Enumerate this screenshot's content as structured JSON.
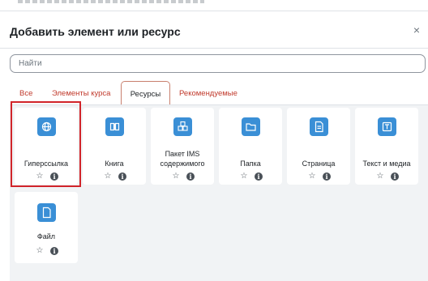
{
  "modal": {
    "title": "Добавить элемент или ресурс",
    "close_glyph": "×"
  },
  "search": {
    "placeholder": "Найти",
    "value": ""
  },
  "tabs": [
    {
      "label": "Все",
      "active": false
    },
    {
      "label": "Элементы курса",
      "active": false
    },
    {
      "label": "Ресурсы",
      "active": true
    },
    {
      "label": "Рекомендуемые",
      "active": false
    }
  ],
  "cards": [
    {
      "label": "Гиперссылка",
      "icon": "globe-icon",
      "selected": true
    },
    {
      "label": "Книга",
      "icon": "book-icon",
      "selected": false
    },
    {
      "label": "Пакет IMS содержимого",
      "icon": "package-icon",
      "selected": false
    },
    {
      "label": "Папка",
      "icon": "folder-icon",
      "selected": false
    },
    {
      "label": "Страница",
      "icon": "page-icon",
      "selected": false
    },
    {
      "label": "Текст и медиа",
      "icon": "text-media-icon",
      "selected": false
    },
    {
      "label": "Файл",
      "icon": "file-icon",
      "selected": false
    }
  ],
  "glyphs": {
    "star": "☆",
    "info": "i"
  },
  "colors": {
    "accent_icon_bg": "#3a8fd6",
    "tab_link": "#c0392b",
    "selection_outline": "#d1242a",
    "grid_bg": "#f1f3f5"
  }
}
